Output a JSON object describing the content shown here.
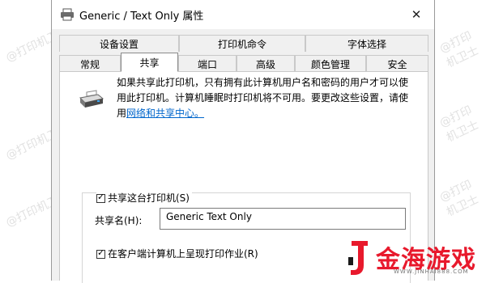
{
  "window": {
    "title": "Generic / Text Only 属性",
    "close_glyph": "✕"
  },
  "tabs": {
    "row1": [
      "设备设置",
      "打印机命令",
      "字体选择"
    ],
    "row2": [
      "常规",
      "共享",
      "端口",
      "高级",
      "颜色管理",
      "安全"
    ],
    "active": "共享"
  },
  "sharing": {
    "info_line1": "如果共享此打印机，只有拥有此计算机用户名和密码的用户才可以使",
    "info_line2": "用此打印机。计算机睡眠时打印机将不可用。要更改这些设置，请使",
    "info_line3_prefix": "用",
    "info_link": "网络和共享中心。",
    "share_checkbox_label": "共享这台打印机(S)",
    "share_checked": true,
    "share_name_label": "共享名(H):",
    "share_name_value": "Generic  Text Only",
    "render_checkbox_label": "在客户端计算机上呈现打印作业(R)",
    "render_checked": true
  },
  "watermark": {
    "text": "@打印机卫士",
    "logo_text": "金海游戏",
    "logo_sub": "WWW.JINHAI888.COM"
  },
  "colors": {
    "accent_link": "#0066cc",
    "logo_red": "#e8192c"
  }
}
